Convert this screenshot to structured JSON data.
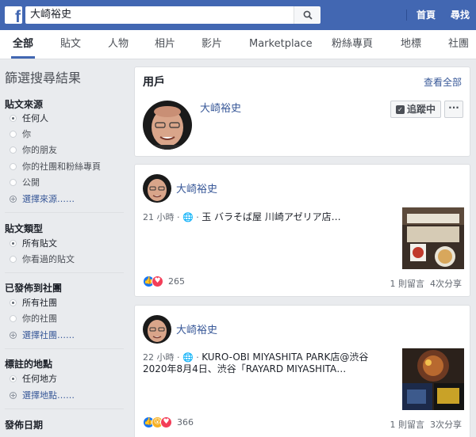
{
  "header": {
    "logo": "f",
    "search_value": "大崎裕史",
    "home_label": "首頁",
    "find_friends_label": "尋找朋"
  },
  "tabs": [
    {
      "label": "全部",
      "active": true
    },
    {
      "label": "貼文"
    },
    {
      "label": "人物"
    },
    {
      "label": "相片"
    },
    {
      "label": "影片"
    },
    {
      "label": "Marketplace"
    },
    {
      "label": "粉絲專頁"
    },
    {
      "label": "地標"
    },
    {
      "label": "社團"
    }
  ],
  "sidebar": {
    "title": "篩選搜尋結果",
    "post_source": {
      "title": "貼文來源",
      "options": [
        "任何人",
        "你",
        "你的朋友",
        "你的社團和粉絲專頁",
        "公開"
      ],
      "more": "選擇來源……"
    },
    "post_type": {
      "title": "貼文類型",
      "options": [
        "所有貼文",
        "你看過的貼文"
      ]
    },
    "posted_in_group": {
      "title": "已發佈到社團",
      "options": [
        "所有社團",
        "你的社團"
      ],
      "more": "選擇社團……"
    },
    "tagged_location": {
      "title": "標註的地點",
      "options": [
        "任何地方"
      ],
      "more": "選擇地點……"
    },
    "date_posted": {
      "title": "發佈日期"
    }
  },
  "users_card": {
    "title": "用戶",
    "see_all": "查看全部",
    "user_name": "大崎裕史",
    "follow_label": "追蹤中",
    "more_label": "···"
  },
  "posts": [
    {
      "author": "大崎裕史",
      "time": "21 小時",
      "text": "玉 バラそば屋 川崎アゼリア店…",
      "reaction_count": "265",
      "comments": "1 則留言",
      "shares": "4次分享"
    },
    {
      "author": "大崎裕史",
      "time": "22 小時",
      "text_line1": "KURO-OBI MIYASHITA PARK店@渋谷",
      "text_line2": "2020年8月4日、渋谷「RAYARD MIYASHITA…",
      "reaction_count": "366",
      "comments": "1 則留言",
      "shares": "3次分享"
    }
  ],
  "colors": {
    "brand": "#4267b2",
    "link": "#385898",
    "background": "#e9ebee"
  }
}
